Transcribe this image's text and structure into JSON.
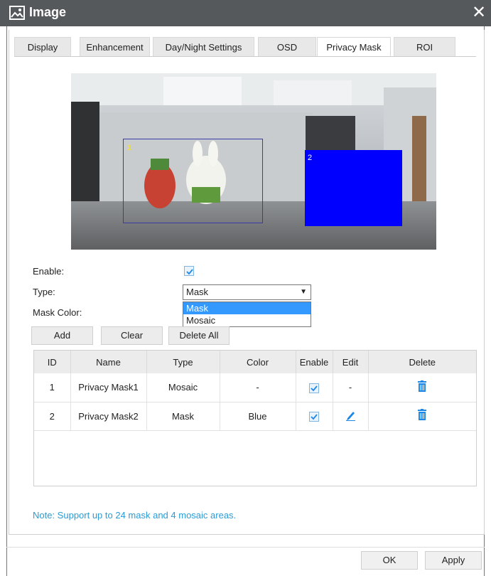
{
  "window": {
    "title": "Image",
    "close_symbol": "✕"
  },
  "tabs": [
    {
      "label": "Display"
    },
    {
      "label": "Enhancement"
    },
    {
      "label": "Day/Night Settings"
    },
    {
      "label": "OSD"
    },
    {
      "label": "Privacy Mask",
      "active": true
    },
    {
      "label": "ROI"
    }
  ],
  "preview": {
    "mask1_id": "1",
    "mask2_id": "2",
    "mask2_color": "#0000ff"
  },
  "form": {
    "enable_label": "Enable:",
    "enable_checked": true,
    "type_label": "Type:",
    "type_value": "Mask",
    "type_options": [
      "Mask",
      "Mosaic"
    ],
    "mask_color_label": "Mask Color:"
  },
  "buttons": {
    "add": "Add",
    "clear": "Clear",
    "delete_all": "Delete All",
    "ok": "OK",
    "apply": "Apply"
  },
  "table": {
    "columns": [
      "ID",
      "Name",
      "Type",
      "Color",
      "Enable",
      "Edit",
      "Delete"
    ],
    "rows": [
      {
        "id": "1",
        "name": "Privacy Mask1",
        "type": "Mosaic",
        "color": "-",
        "enable": true,
        "edit": "-",
        "delete_icon": "trash-icon"
      },
      {
        "id": "2",
        "name": "Privacy Mask2",
        "type": "Mask",
        "color": "Blue",
        "enable": true,
        "edit_icon": "pencil-icon",
        "delete_icon": "trash-icon"
      }
    ]
  },
  "note": "Note: Support up to 24 mask and 4 mosaic areas.",
  "colors": {
    "titlebar": "#55595c",
    "accent": "#1e88e5",
    "note_text": "#2a9bd6",
    "selection": "#3399ff"
  }
}
